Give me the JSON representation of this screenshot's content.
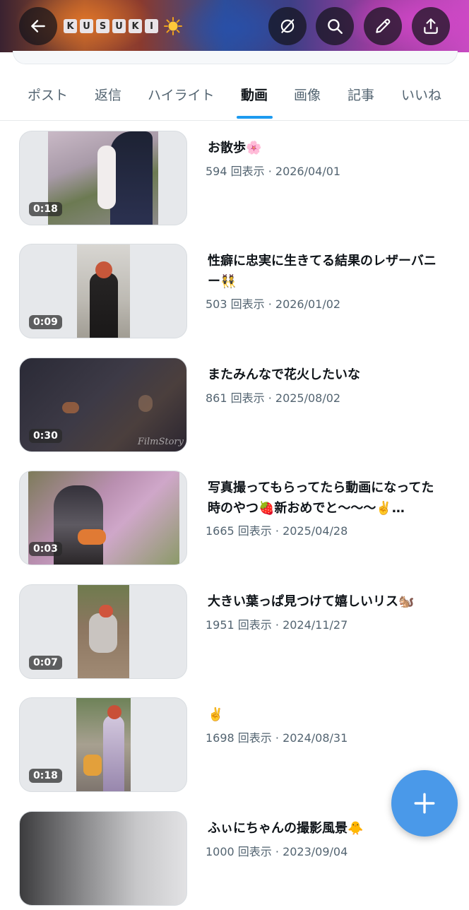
{
  "profile": {
    "brand_letters": [
      "K",
      "U",
      "S",
      "U",
      "K",
      "I"
    ],
    "brand_emoji": "sun-icon"
  },
  "header": {
    "buttons": [
      "back-arrow-icon",
      "grok-icon",
      "search-icon",
      "edit-pencil-icon",
      "share-upload-icon"
    ]
  },
  "tabs": [
    {
      "label": "ポスト"
    },
    {
      "label": "返信"
    },
    {
      "label": "ハイライト"
    },
    {
      "label": "動画"
    },
    {
      "label": "画像"
    },
    {
      "label": "記事"
    },
    {
      "label": "いいね"
    }
  ],
  "active_tab": "動画",
  "videos": [
    {
      "title": "お散歩🌸",
      "views": "594 回表示 · 2026/04/01",
      "duration": "0:18"
    },
    {
      "title": "性癖に忠実に生きてる結果のレザーバニー👯",
      "views": "503 回表示 · 2026/01/02",
      "duration": "0:09"
    },
    {
      "title": "またみんなで花火したいな",
      "views": "861 回表示 · 2025/08/02",
      "duration": "0:30",
      "watermark": "FilmStory"
    },
    {
      "title": "写真撮ってもらってたら動画になってた時のやつ🍓新おめでと〜〜〜✌️…",
      "views": "1665 回表示 · 2025/04/28",
      "duration": "0:03"
    },
    {
      "title": "大きい葉っぱ見つけて嬉しいリス🐿️",
      "views": "1951 回表示 · 2024/11/27",
      "duration": "0:07"
    },
    {
      "title": "✌️",
      "views": "1698 回表示 · 2024/08/31",
      "duration": "0:18"
    },
    {
      "title": "ふぃにちゃんの撮影風景🐥",
      "views": "1000 回表示 · 2023/09/04",
      "duration": ""
    }
  ],
  "fab": {
    "icon": "plus-icon"
  },
  "colors": {
    "accent": "#1d9bf0",
    "fab": "#4a99e9",
    "secondary_text": "#536471"
  }
}
